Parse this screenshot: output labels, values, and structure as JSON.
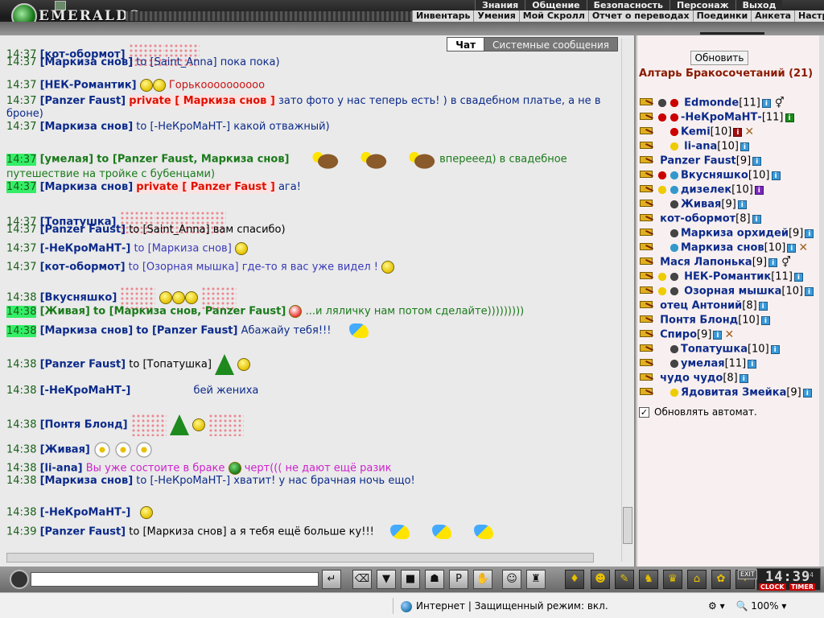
{
  "header": {
    "logo_text": "EMERALDS",
    "menu_top": [
      "Знания",
      "Общение",
      "Безопасность",
      "Персонаж",
      "Выход"
    ],
    "menu_second": [
      "Инвентарь",
      "Умения",
      "Мой Скролл",
      "Отчет о переводах",
      "Поединки",
      "Анкета",
      "Настрой"
    ]
  },
  "tabs": {
    "chat": "Чат",
    "system": "Системные сообщения"
  },
  "chat": {
    "lines": [
      {
        "time": "14:37",
        "nick": "[кот-обормот]",
        "text": ""
      },
      {
        "time": "14:37",
        "nick": "[Маркиза снов]",
        "to": "to [Saint_Anna]",
        "text": "пока пока)"
      },
      {
        "time": "14:37",
        "nick": "[НЕК-Романтик]",
        "text": "Горькоооооооооо"
      },
      {
        "time": "14:37",
        "nick": "[Panzer Faust]",
        "private": "private [ Маркиза снов ]",
        "text": "зато фото у нас теперь есть! ) в свадебном платье, а не в"
      },
      {
        "text": "броне)"
      },
      {
        "time": "14:37",
        "nick": "[Маркиза снов]",
        "to": "to [-НеКроМаНТ-]",
        "text": "какой отважный)"
      },
      {
        "time": "14:37",
        "nick": "[умелая]",
        "to": "to [Panzer Faust, Маркиза снов]",
        "text": "вперееед) в свадебное"
      },
      {
        "text": "путешествие на тройке с бубенцами)"
      },
      {
        "time": "14:37",
        "nick": "[Маркиза снов]",
        "private": "private [ Panzer Faust ]",
        "text": "ага!"
      },
      {
        "time": "14:37",
        "nick": "[Топатушка]",
        "text": ""
      },
      {
        "time": "14:37",
        "nick": "[Panzer Faust]",
        "to": "to [Saint_Anna]",
        "text": "вам спасибо)"
      },
      {
        "time": "14:37",
        "nick": "[-НеКроМаНТ-]",
        "to": "to [Маркиза снов]",
        "text": ""
      },
      {
        "time": "14:37",
        "nick": "[кот-обормот]",
        "to": "to [Озорная мышка]",
        "text": "где-то я вас уже видел !"
      },
      {
        "time": "14:38",
        "nick": "[Вкусняшко]",
        "text": ""
      },
      {
        "time": "14:38",
        "nick": "[Живая]",
        "to": "to [Маркиза снов, Panzer Faust]",
        "text": "...и ляличку нам потом сделайте)))))))))"
      },
      {
        "time": "14:38",
        "nick": "[Маркиза снов]",
        "to": "to [Panzer Faust]",
        "text": "Абажайу тебя!!!"
      },
      {
        "time": "14:38",
        "nick": "[Panzer Faust]",
        "to": "to [Топатушка]",
        "text": ""
      },
      {
        "time": "14:38",
        "nick": "[-НеКроМаНТ-]",
        "text": "бей жениха"
      },
      {
        "time": "14:38",
        "nick": "[Понтя Блонд]",
        "text": ""
      },
      {
        "time": "14:38",
        "nick": "[Живая]",
        "text": ""
      },
      {
        "time": "14:38",
        "nick": "[li-ana]",
        "text": "Вы уже состоите в браке",
        "text2": "черт((( не дают ещё разик"
      },
      {
        "time": "14:38",
        "nick": "[Маркиза снов]",
        "to": "to [-НеКроМаНТ-]",
        "text": "хватит! у нас брачная ночь ещо!"
      },
      {
        "time": "14:38",
        "nick": "[-НеКроМаНТ-]",
        "text": ""
      },
      {
        "time": "14:39",
        "nick": "[Panzer Faust]",
        "to": "to [Маркиза снов]",
        "text": "а я тебя ещё больше ку!!!"
      }
    ]
  },
  "right_panel": {
    "refresh_label": "Обновить",
    "room_title": "Алтарь Бракосочетаний",
    "room_count": "(21)",
    "auto_refresh_label": "Обновлять автомат.",
    "users": [
      {
        "name": "Edmonde",
        "level": "[11]"
      },
      {
        "name": "-НеКроМаНТ-",
        "level": "[11]"
      },
      {
        "name": "Kemi",
        "level": "[10]"
      },
      {
        "name": "li-ana",
        "level": "[10]"
      },
      {
        "name": "Panzer Faust",
        "level": "[9]"
      },
      {
        "name": "Вкусняшко",
        "level": "[10]"
      },
      {
        "name": "дизелек",
        "level": "[10]"
      },
      {
        "name": "Живая",
        "level": "[9]"
      },
      {
        "name": "кот-обормот",
        "level": "[8]"
      },
      {
        "name": "Маркиза орхидей",
        "level": "[9]"
      },
      {
        "name": "Маркиза снов",
        "level": "[10]"
      },
      {
        "name": "Мася Лапонька",
        "level": "[9]"
      },
      {
        "name": "НЕК-Романтик",
        "level": "[11]"
      },
      {
        "name": "Озорная мышка",
        "level": "[10]"
      },
      {
        "name": "отец Антоний",
        "level": "[8]"
      },
      {
        "name": "Понтя Блонд",
        "level": "[10]"
      },
      {
        "name": "Спиро",
        "level": "[9]"
      },
      {
        "name": "Топатушка",
        "level": "[10]"
      },
      {
        "name": "умелая",
        "level": "[11]"
      },
      {
        "name": "чудо чудо",
        "level": "[8]"
      },
      {
        "name": "Ядовитая Змейка",
        "level": "[9]"
      }
    ]
  },
  "toolbar": {
    "clock_time": "14:39",
    "clock_seconds": "14",
    "clock_label": "CLOCK",
    "timer_label": "TIMER",
    "exit_label": "EXIT",
    "input_value": ""
  },
  "statusbar": {
    "zone": "Интернет | Защищенный режим: вкл.",
    "zoom": "100%"
  }
}
